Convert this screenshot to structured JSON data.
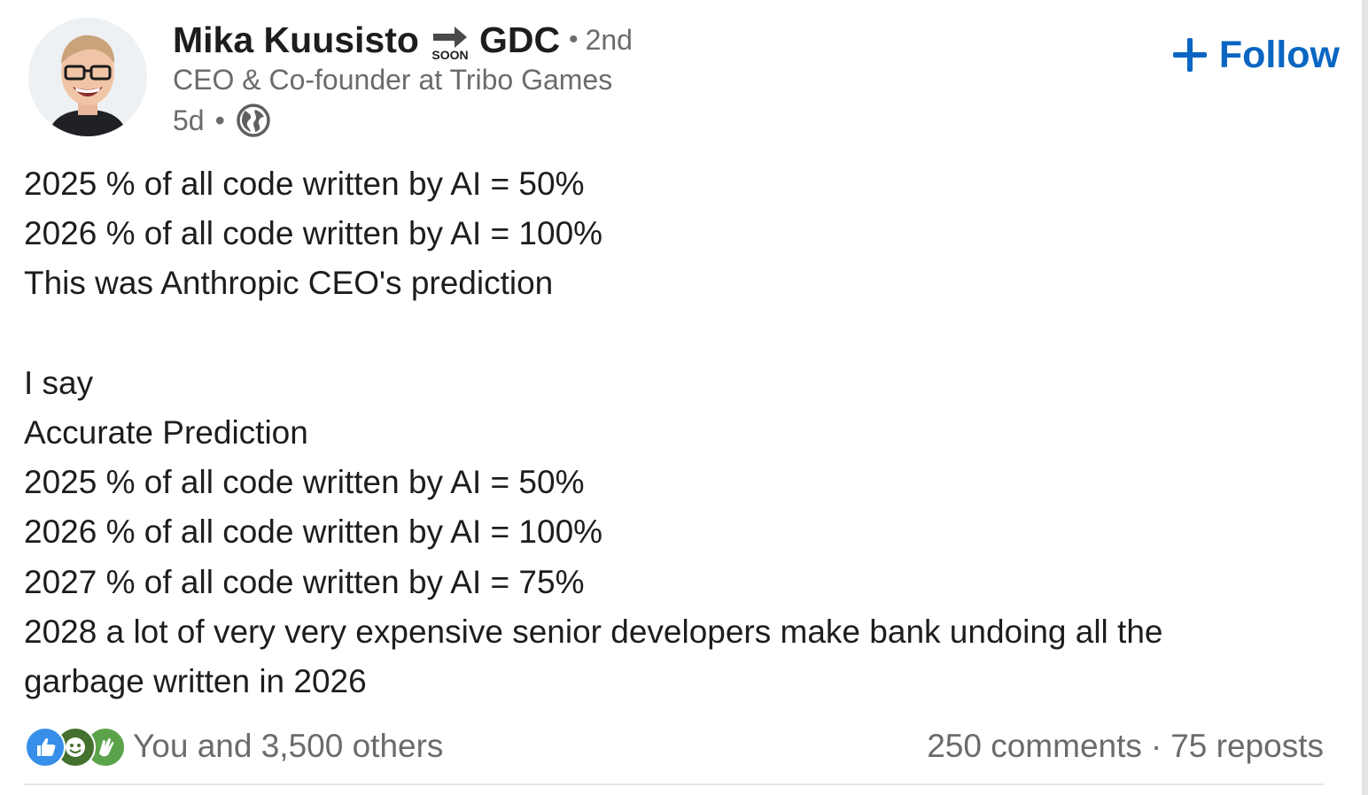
{
  "post": {
    "author": {
      "name": "Mika Kuusisto",
      "badge_text": "SOON",
      "badge_suffix": "GDC",
      "connection_degree": "2nd",
      "headline": "CEO & Co-founder at Tribo Games",
      "age": "5d",
      "visibility_icon": "globe-icon"
    },
    "follow_label": "Follow",
    "body_lines": [
      "2025 % of all code written by AI = 50%",
      "2026 % of all code written by AI = 100%",
      "This was Anthropic CEO's prediction",
      "",
      "I say",
      "Accurate Prediction",
      "2025 % of all code written by AI = 50%",
      "2026 % of all code written by AI = 100%",
      "2027 % of all code written by AI = 75%",
      "2028 a lot of very very expensive senior developers make bank undoing all the",
      "garbage written in 2026"
    ],
    "social": {
      "reaction_icons": [
        "like-icon",
        "love-icon",
        "clap-icon"
      ],
      "reactions_text": "You and 3,500 others",
      "comments_text": "250 comments",
      "reposts_text": "75 reposts"
    }
  },
  "colors": {
    "accent": "#0a66c2",
    "text_primary": "#1d1d1d",
    "text_secondary": "#6b6b6b"
  }
}
